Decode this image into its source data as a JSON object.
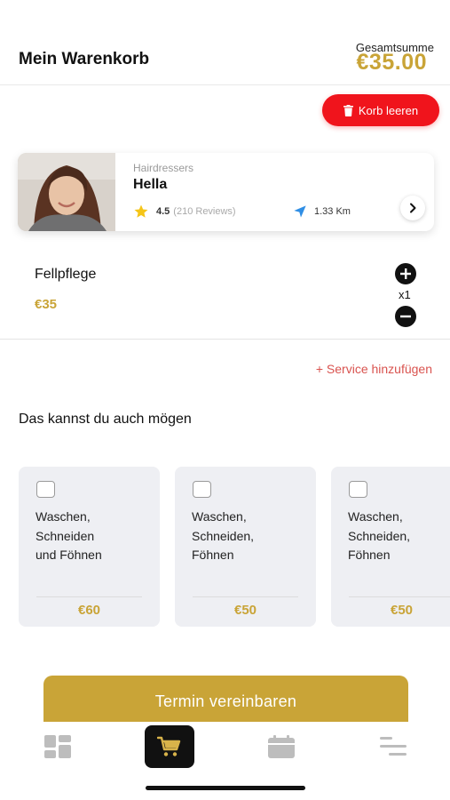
{
  "header": {
    "title": "Mein Warenkorb",
    "total_label": "Gesamtsumme",
    "total_value": "€35.00"
  },
  "clear_cart": {
    "label": "Korb leeren",
    "color": "#f0141c"
  },
  "salon": {
    "category": "Hairdressers",
    "name": "Hella",
    "rating": "4.5",
    "reviews": "(210 Reviews)",
    "distance": "1.33 Km"
  },
  "cart_item": {
    "name": "Fellpflege",
    "price": "€35",
    "quantity": "x1"
  },
  "add_service_label": "+ Service hinzufügen",
  "recommendations": {
    "title": "Das kannst du auch mögen",
    "items": [
      {
        "lines": [
          "Waschen,",
          "Schneiden",
          "und Föhnen"
        ],
        "price": "€60"
      },
      {
        "lines": [
          "Waschen,",
          "Schneiden,",
          "Föhnen"
        ],
        "price": "€50"
      },
      {
        "lines": [
          "Waschen,",
          "Schneiden,",
          "Föhnen"
        ],
        "price": "€50"
      }
    ]
  },
  "book_button": {
    "label": "Termin vereinbaren"
  },
  "tabs": [
    {
      "icon": "dashboard-icon",
      "active": false
    },
    {
      "icon": "cart-icon",
      "active": true
    },
    {
      "icon": "calendar-icon",
      "active": false
    },
    {
      "icon": "menu-icon",
      "active": false
    }
  ],
  "colors": {
    "accent": "#c9a437",
    "danger": "#f0141c",
    "link": "#d9534f"
  }
}
